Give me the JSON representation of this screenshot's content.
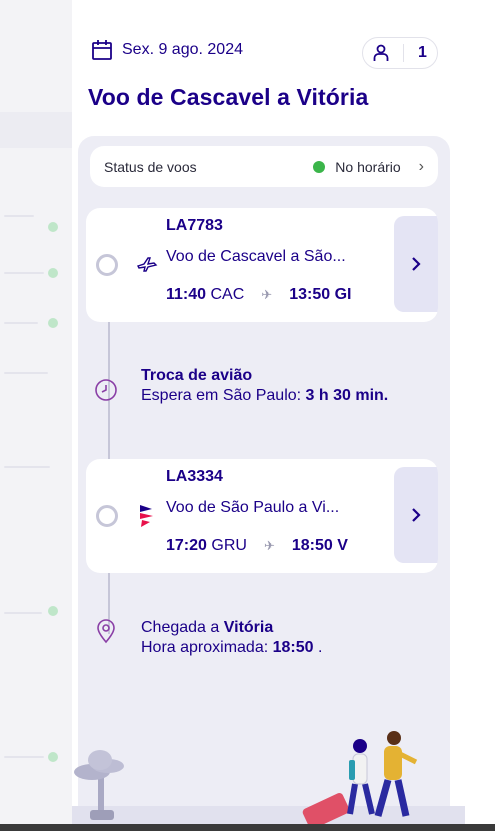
{
  "header": {
    "date": "Sex. 9 ago. 2024",
    "passengers": "1",
    "title": "Voo de Cascavel a Vitória"
  },
  "status": {
    "label": "Status de voos",
    "value": "No horário",
    "value_color": "#3bb54a"
  },
  "flights": [
    {
      "number": "LA7783",
      "description": "Voo de Cascavel a São...",
      "depart_time": "11:40",
      "depart_code": "CAC",
      "arrive_time": "13:50",
      "arrive_code": "GI"
    },
    {
      "number": "LA3334",
      "description": "Voo de São Paulo a Vi...",
      "depart_time": "17:20",
      "depart_code": "GRU",
      "arrive_time": "18:50",
      "arrive_code": "V"
    }
  ],
  "connection": {
    "title": "Troca de avião",
    "wait_label": "Espera em São Paulo:",
    "wait_value": "3 h 30 min."
  },
  "arrival": {
    "label": "Chegada a",
    "city": "Vitória",
    "eta_label": "Hora aproximada:",
    "eta_value": "18:50",
    "eta_suffix": "."
  },
  "colors": {
    "brand": "#1b0088",
    "accent_pink": "#e8114b",
    "panel_bg": "#ededf5"
  }
}
